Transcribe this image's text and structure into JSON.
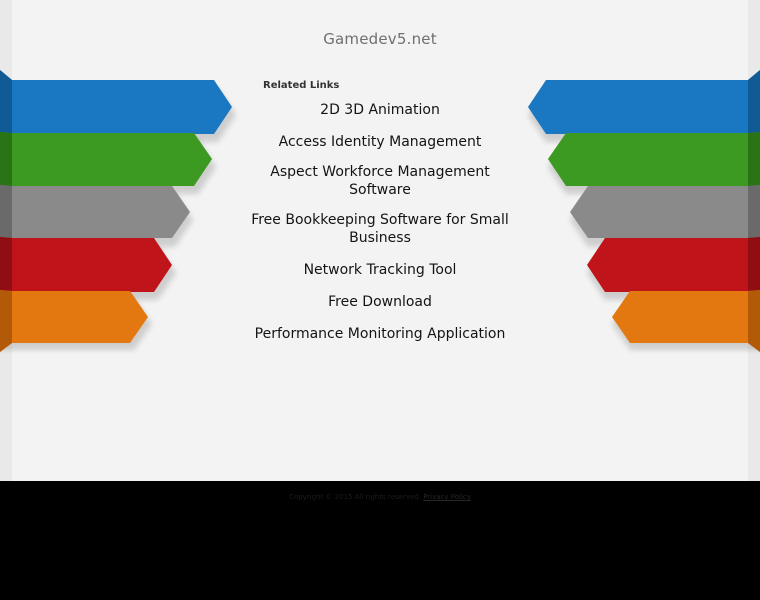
{
  "site": {
    "title": "Gamedev5.net"
  },
  "related": {
    "heading": "Related Links",
    "links": [
      "2D 3D Animation",
      "Access Identity Management",
      "Aspect Workforce Management Software",
      "Free Bookkeeping Software for Small Business",
      "Network Tracking Tool",
      "Free Download",
      "Performance Monitoring Application"
    ]
  },
  "ribbons": {
    "colors": [
      "#1a78c2",
      "#3c9a22",
      "#8a8a8a",
      "#c0141b",
      "#e2780f"
    ],
    "icon": "colored-ribbon-arrows"
  },
  "footer": {
    "copyright": "Copyright © 2015 All rights reserved.",
    "privacy_label": "Privacy Policy"
  }
}
